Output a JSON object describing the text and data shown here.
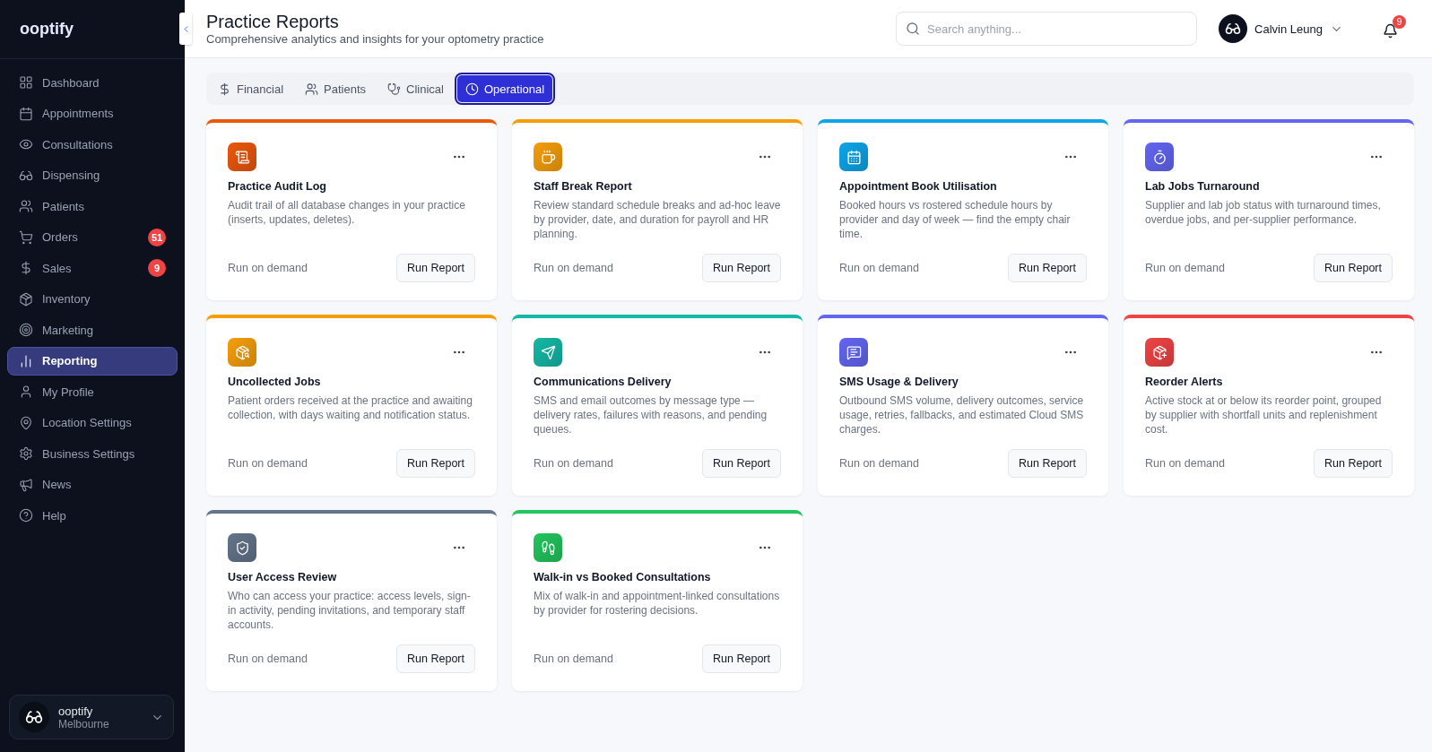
{
  "brand": "ooptify",
  "nav": [
    {
      "label": "Dashboard",
      "selected": false
    },
    {
      "label": "Appointments",
      "selected": false
    },
    {
      "label": "Consultations",
      "selected": false
    },
    {
      "label": "Dispensing",
      "selected": false
    },
    {
      "label": "Patients",
      "selected": false
    },
    {
      "label": "Orders",
      "selected": false,
      "badge": "51"
    },
    {
      "label": "Sales",
      "selected": false,
      "badge": "9"
    },
    {
      "label": "Inventory",
      "selected": false
    },
    {
      "label": "Marketing",
      "selected": false
    },
    {
      "label": "Reporting",
      "selected": true
    },
    {
      "label": "My Profile",
      "selected": false
    },
    {
      "label": "Location Settings",
      "selected": false
    },
    {
      "label": "Business Settings",
      "selected": false
    },
    {
      "label": "News",
      "selected": false
    },
    {
      "label": "Help",
      "selected": false
    }
  ],
  "location": {
    "name": "ooptify",
    "place": "Melbourne"
  },
  "header": {
    "title": "Practice Reports",
    "subtitle": "Comprehensive analytics and insights for your optometry practice"
  },
  "search": {
    "placeholder": "Search anything..."
  },
  "user": {
    "name": "Calvin Leung"
  },
  "notifications": {
    "count": "9"
  },
  "tabs": [
    {
      "label": "Financial",
      "selected": false
    },
    {
      "label": "Patients",
      "selected": false
    },
    {
      "label": "Clinical",
      "selected": false
    },
    {
      "label": "Operational",
      "selected": true
    }
  ],
  "reports": [
    {
      "title": "Practice Audit Log",
      "description": "Audit trail of all database changes in your practice (inserts, updates, deletes).",
      "schedule": "Run on demand",
      "action": "Run Report",
      "color": "#ea580c"
    },
    {
      "title": "Staff Break Report",
      "description": "Review standard schedule breaks and ad-hoc leave by provider, date, and duration for payroll and HR planning.",
      "schedule": "Run on demand",
      "action": "Run Report",
      "color": "#f59e0b"
    },
    {
      "title": "Appointment Book Utilisation",
      "description": "Booked hours vs rostered schedule hours by provider and day of week — find the empty chair time.",
      "schedule": "Run on demand",
      "action": "Run Report",
      "color": "#0ea5e9"
    },
    {
      "title": "Lab Jobs Turnaround",
      "description": "Supplier and lab job status with turnaround times, overdue jobs, and per-supplier performance.",
      "schedule": "Run on demand",
      "action": "Run Report",
      "color": "#6366f1"
    },
    {
      "title": "Uncollected Jobs",
      "description": "Patient orders received at the practice and awaiting collection, with days waiting and notification status.",
      "schedule": "Run on demand",
      "action": "Run Report",
      "color": "#f59e0b"
    },
    {
      "title": "Communications Delivery",
      "description": "SMS and email outcomes by message type — delivery rates, failures with reasons, and pending queues.",
      "schedule": "Run on demand",
      "action": "Run Report",
      "color": "#14b8a6"
    },
    {
      "title": "SMS Usage & Delivery",
      "description": "Outbound SMS volume, delivery outcomes, service usage, retries, fallbacks, and estimated Cloud SMS charges.",
      "schedule": "Run on demand",
      "action": "Run Report",
      "color": "#6366f1"
    },
    {
      "title": "Reorder Alerts",
      "description": "Active stock at or below its reorder point, grouped by supplier with shortfall units and replenishment cost.",
      "schedule": "Run on demand",
      "action": "Run Report",
      "color": "#ef4444"
    },
    {
      "title": "User Access Review",
      "description": "Who can access your practice: access levels, sign-in activity, pending invitations, and temporary staff accounts.",
      "schedule": "Run on demand",
      "action": "Run Report",
      "color": "#64748b"
    },
    {
      "title": "Walk-in vs Booked Consultations",
      "description": "Mix of walk-in and appointment-linked consultations by provider for rostering decisions.",
      "schedule": "Run on demand",
      "action": "Run Report",
      "color": "#22c55e"
    }
  ]
}
